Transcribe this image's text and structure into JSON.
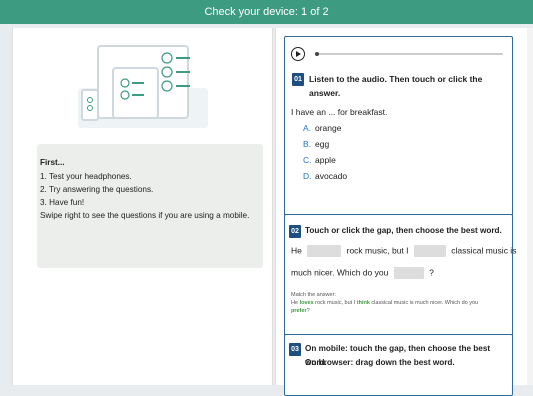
{
  "topbar": {
    "title": "Check your device: 1 of 2"
  },
  "left": {
    "first_title": "First...",
    "steps": [
      "1. Test your headphones.",
      "2. Try answering the questions.",
      "3. Have fun!",
      "Swipe right to see the questions if you are using a mobile."
    ]
  },
  "q1": {
    "number": "01",
    "instruction_line1": "Listen to the audio. Then touch or click the",
    "instruction_line2": "answer.",
    "prompt": "I have an ... for breakfast.",
    "options": [
      {
        "letter": "A.",
        "text": "orange"
      },
      {
        "letter": "B.",
        "text": "egg"
      },
      {
        "letter": "C.",
        "text": "apple"
      },
      {
        "letter": "D.",
        "text": "avocado"
      }
    ],
    "audio_progress": 0
  },
  "q2": {
    "number": "02",
    "instruction": "Touch or click the gap, then choose the best word.",
    "sentence": {
      "part1": "He",
      "part2": "rock music, but I",
      "part3": "classical music is",
      "part4": "much nicer. Which do you",
      "part5": "?"
    },
    "match_label": "Match the answer:",
    "match_example": {
      "a": "He ",
      "b": "loves",
      "c": " rock music, but I ",
      "d": "think",
      "e": " classical music is much nicer. Which do you",
      "f": "prefer",
      "g": "?"
    }
  },
  "q3": {
    "number": "03",
    "instruction_line1": "On mobile: touch the gap, then choose the best word.",
    "instruction_line2": "On browser: drag down the best word."
  },
  "colors": {
    "accent": "#3d9b82",
    "question_badge": "#1f4f80",
    "option_letter": "#2277cc",
    "highlight": "#3b9c3f"
  }
}
